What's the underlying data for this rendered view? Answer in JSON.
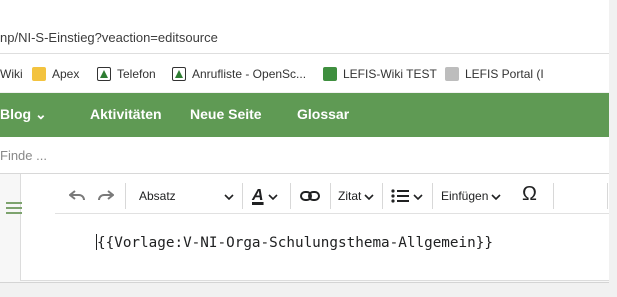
{
  "address_bar": {
    "url": "np/NI-S-Einstieg?veaction=editsource"
  },
  "bookmarks": [
    {
      "label": "Wiki",
      "icon": "none"
    },
    {
      "label": "Apex",
      "icon": "folder-icon"
    },
    {
      "label": "Telefon",
      "icon": "team-icon"
    },
    {
      "label": "Anrufliste - OpenSc...",
      "icon": "team-icon"
    },
    {
      "label": "LEFIS-Wiki TEST",
      "icon": "lefis-icon"
    },
    {
      "label": "LEFIS Portal (I",
      "icon": "portal-icon"
    }
  ],
  "navbar": {
    "items": [
      {
        "label": "Blog ⌄"
      },
      {
        "label": "Aktivitäten"
      },
      {
        "label": "Neue Seite"
      },
      {
        "label": "Glossar"
      }
    ],
    "color": "#5f9a54"
  },
  "search": {
    "placeholder": "Finde ..."
  },
  "toolbar": {
    "paragraph_label": "Absatz",
    "cite_label": "Zitat",
    "insert_label": "Einfügen",
    "special_char": "Ω",
    "text_style": "A"
  },
  "editor": {
    "content": "{{Vorlage:V-NI-Orga-Schulungsthema-Allgemein}}"
  }
}
